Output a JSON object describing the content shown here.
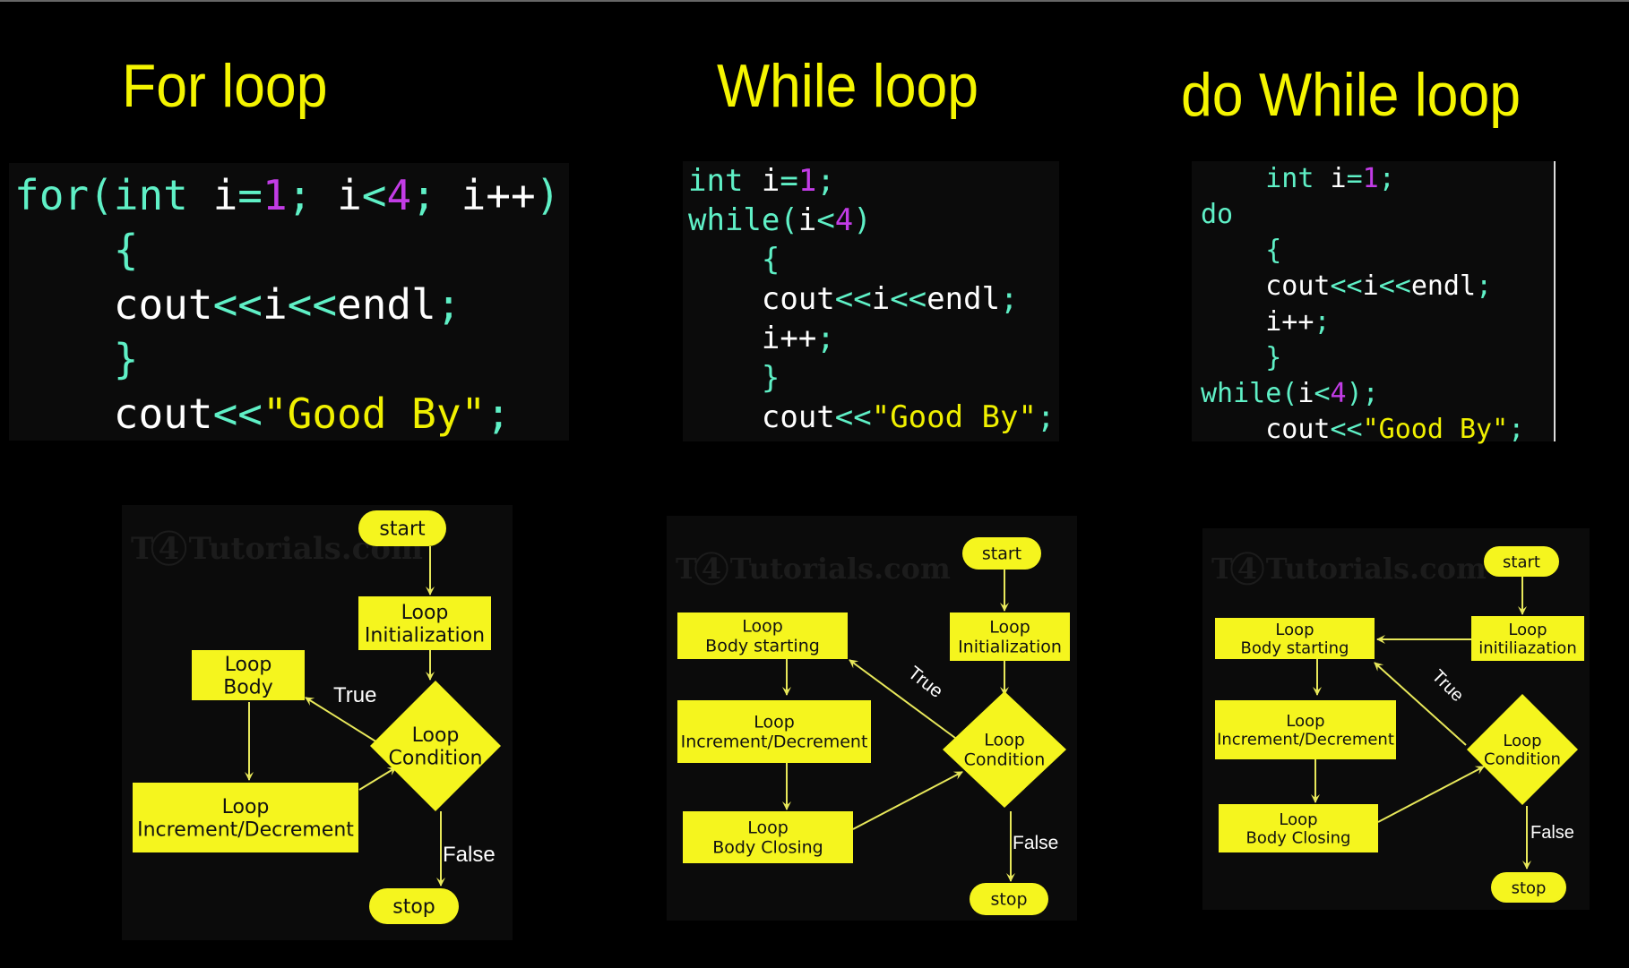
{
  "colors": {
    "background": "#000000",
    "title": "#f5f500",
    "keyword": "#5ff0c6",
    "number": "#c23ce6",
    "string": "#f0f000",
    "identifier": "#ffffff",
    "node_fill": "#f5f51e",
    "edge": "#e8e85a",
    "edge_label": "#ffffff"
  },
  "titles": {
    "for": "For loop",
    "while": "While loop",
    "do_while": "do While loop"
  },
  "code": {
    "for": [
      [
        [
          "kw",
          "for("
        ],
        [
          "kw",
          "int "
        ],
        [
          "var",
          "i"
        ],
        [
          "pun",
          "="
        ],
        [
          "num",
          "1"
        ],
        [
          "pun",
          "; "
        ],
        [
          "var",
          "i"
        ],
        [
          "pun",
          "<"
        ],
        [
          "num",
          "4"
        ],
        [
          "pun",
          "; "
        ],
        [
          "var",
          "i++"
        ],
        [
          "kw",
          ")"
        ]
      ],
      [
        [
          "pun",
          "    {"
        ]
      ],
      [
        [
          "var",
          "    cout"
        ],
        [
          "pun",
          "<<"
        ],
        [
          "var",
          "i"
        ],
        [
          "pun",
          "<<"
        ],
        [
          "var",
          "endl"
        ],
        [
          "pun",
          ";"
        ]
      ],
      [
        [
          "pun",
          "    }"
        ]
      ],
      [
        [
          "var",
          "    cout"
        ],
        [
          "pun",
          "<<"
        ],
        [
          "str",
          "\"Good By\""
        ],
        [
          "pun",
          ";"
        ]
      ]
    ],
    "while": [
      [
        [
          "kw",
          "int "
        ],
        [
          "var",
          "i"
        ],
        [
          "pun",
          "="
        ],
        [
          "num",
          "1"
        ],
        [
          "pun",
          ";"
        ]
      ],
      [
        [
          "kw",
          "while("
        ],
        [
          "var",
          "i"
        ],
        [
          "pun",
          "<"
        ],
        [
          "num",
          "4"
        ],
        [
          "kw",
          ")"
        ]
      ],
      [
        [
          "pun",
          "    {"
        ]
      ],
      [
        [
          "var",
          "    cout"
        ],
        [
          "pun",
          "<<"
        ],
        [
          "var",
          "i"
        ],
        [
          "pun",
          "<<"
        ],
        [
          "var",
          "endl"
        ],
        [
          "pun",
          ";"
        ]
      ],
      [
        [
          "var",
          "    i++"
        ],
        [
          "pun",
          ";"
        ]
      ],
      [
        [
          "pun",
          "    }"
        ]
      ],
      [
        [
          "var",
          "    cout"
        ],
        [
          "pun",
          "<<"
        ],
        [
          "str",
          "\"Good By\""
        ],
        [
          "pun",
          ";"
        ]
      ]
    ],
    "do_while": [
      [
        [
          "kw",
          "    int "
        ],
        [
          "var",
          "i"
        ],
        [
          "pun",
          "="
        ],
        [
          "num",
          "1"
        ],
        [
          "pun",
          ";"
        ]
      ],
      [
        [
          "kw",
          "do"
        ]
      ],
      [
        [
          "pun",
          "    {"
        ]
      ],
      [
        [
          "var",
          "    cout"
        ],
        [
          "pun",
          "<<"
        ],
        [
          "var",
          "i"
        ],
        [
          "pun",
          "<<"
        ],
        [
          "var",
          "endl"
        ],
        [
          "pun",
          ";"
        ]
      ],
      [
        [
          "var",
          "    i++"
        ],
        [
          "pun",
          ";"
        ]
      ],
      [
        [
          "pun",
          "    }"
        ]
      ],
      [
        [
          "kw",
          "while("
        ],
        [
          "var",
          "i"
        ],
        [
          "pun",
          "<"
        ],
        [
          "num",
          "4"
        ],
        [
          "kw",
          ")"
        ],
        [
          "pun",
          ";"
        ]
      ],
      [
        [
          "var",
          "    cout"
        ],
        [
          "pun",
          "<<"
        ],
        [
          "str",
          "\"Good By\""
        ],
        [
          "pun",
          ";"
        ]
      ]
    ]
  },
  "watermark": {
    "prefix": "T",
    "circled": "4",
    "suffix": "Tutorials.com"
  },
  "flowcharts": {
    "for": {
      "nodes": [
        {
          "id": "start",
          "shape": "terminal",
          "lines": [
            "start"
          ]
        },
        {
          "id": "init",
          "shape": "rect",
          "lines": [
            "Loop",
            "Initialization"
          ]
        },
        {
          "id": "cond",
          "shape": "diamond",
          "lines": [
            "Loop",
            "Condition"
          ]
        },
        {
          "id": "body",
          "shape": "rect",
          "lines": [
            "Loop",
            "Body"
          ]
        },
        {
          "id": "incr",
          "shape": "rect",
          "lines": [
            "Loop",
            "Increment/Decrement"
          ]
        },
        {
          "id": "stop",
          "shape": "terminal",
          "lines": [
            "stop"
          ]
        }
      ],
      "edges": [
        {
          "from": "start",
          "to": "init",
          "label": ""
        },
        {
          "from": "init",
          "to": "cond",
          "label": ""
        },
        {
          "from": "cond",
          "to": "body",
          "label": "True"
        },
        {
          "from": "body",
          "to": "incr",
          "label": ""
        },
        {
          "from": "incr",
          "to": "cond",
          "label": ""
        },
        {
          "from": "cond",
          "to": "stop",
          "label": "False"
        }
      ]
    },
    "while": {
      "nodes": [
        {
          "id": "start",
          "shape": "terminal",
          "lines": [
            "start"
          ]
        },
        {
          "id": "init",
          "shape": "rect",
          "lines": [
            "Loop",
            "Initialization"
          ]
        },
        {
          "id": "cond",
          "shape": "diamond",
          "lines": [
            "Loop",
            "Condition"
          ]
        },
        {
          "id": "bodystart",
          "shape": "rect",
          "lines": [
            "Loop",
            "Body starting"
          ]
        },
        {
          "id": "incr",
          "shape": "rect",
          "lines": [
            "Loop",
            "Increment/Decrement"
          ]
        },
        {
          "id": "bodyclose",
          "shape": "rect",
          "lines": [
            "Loop",
            "Body Closing"
          ]
        },
        {
          "id": "stop",
          "shape": "terminal",
          "lines": [
            "stop"
          ]
        }
      ],
      "edges": [
        {
          "from": "start",
          "to": "init",
          "label": ""
        },
        {
          "from": "init",
          "to": "cond",
          "label": ""
        },
        {
          "from": "cond",
          "to": "bodystart",
          "label": "True"
        },
        {
          "from": "bodystart",
          "to": "incr",
          "label": ""
        },
        {
          "from": "incr",
          "to": "bodyclose",
          "label": ""
        },
        {
          "from": "bodyclose",
          "to": "cond",
          "label": ""
        },
        {
          "from": "cond",
          "to": "stop",
          "label": "False"
        }
      ]
    },
    "do_while": {
      "nodes": [
        {
          "id": "start",
          "shape": "terminal",
          "lines": [
            "start"
          ]
        },
        {
          "id": "init",
          "shape": "rect",
          "lines": [
            "Loop",
            "initiliazation"
          ]
        },
        {
          "id": "bodystart",
          "shape": "rect",
          "lines": [
            "Loop",
            "Body starting"
          ]
        },
        {
          "id": "incr",
          "shape": "rect",
          "lines": [
            "Loop",
            "Increment/Decrement"
          ]
        },
        {
          "id": "bodyclose",
          "shape": "rect",
          "lines": [
            "Loop",
            "Body Closing"
          ]
        },
        {
          "id": "cond",
          "shape": "diamond",
          "lines": [
            "Loop",
            "Condition"
          ]
        },
        {
          "id": "stop",
          "shape": "terminal",
          "lines": [
            "stop"
          ]
        }
      ],
      "edges": [
        {
          "from": "start",
          "to": "init",
          "label": ""
        },
        {
          "from": "init",
          "to": "bodystart",
          "label": ""
        },
        {
          "from": "bodystart",
          "to": "incr",
          "label": ""
        },
        {
          "from": "incr",
          "to": "bodyclose",
          "label": ""
        },
        {
          "from": "bodyclose",
          "to": "cond",
          "label": ""
        },
        {
          "from": "cond",
          "to": "bodystart",
          "label": "True"
        },
        {
          "from": "cond",
          "to": "stop",
          "label": "False"
        }
      ]
    }
  }
}
